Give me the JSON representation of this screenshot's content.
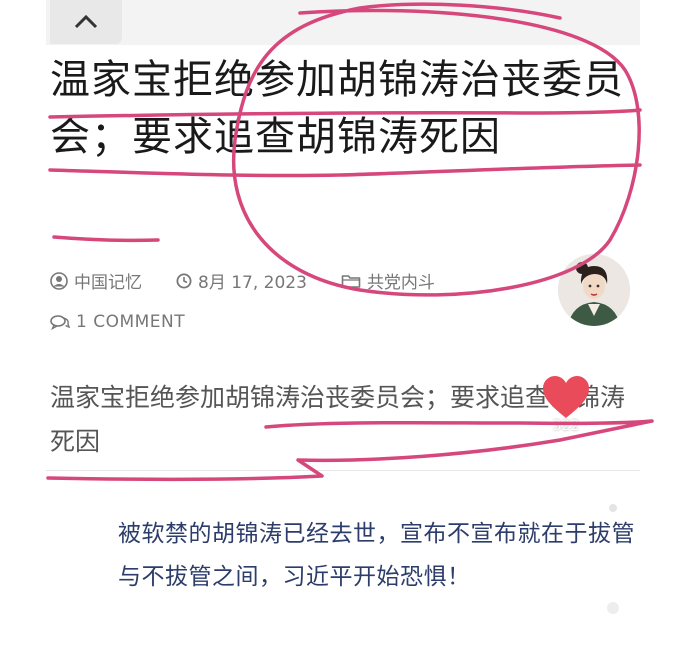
{
  "article": {
    "title": "温家宝拒绝参加胡锦涛治丧委员会；要求追查胡锦涛死因",
    "meta": {
      "author": "中国记忆",
      "date": "8月 17, 2023",
      "category": "共党内斗",
      "comments": "1 COMMENT"
    },
    "summary": "温家宝拒绝参加胡锦涛治丧委员会；要求追查胡锦涛死因",
    "body": "被软禁的胡锦涛已经去世，宣布不宣布就在于拔管与不拔管之间，习近平开始恐惧！"
  },
  "overlay": {
    "like_count": "322"
  },
  "icons": {
    "collapse": "chevron-up-icon",
    "author": "user-icon",
    "date": "clock-icon",
    "category": "folder-icon",
    "comments": "comments-icon",
    "like": "heart-icon"
  },
  "colors": {
    "annotation": "#d6477c",
    "heart": "#ea4b5b",
    "body_text": "#2c3d6b",
    "meta_text": "#777777"
  }
}
